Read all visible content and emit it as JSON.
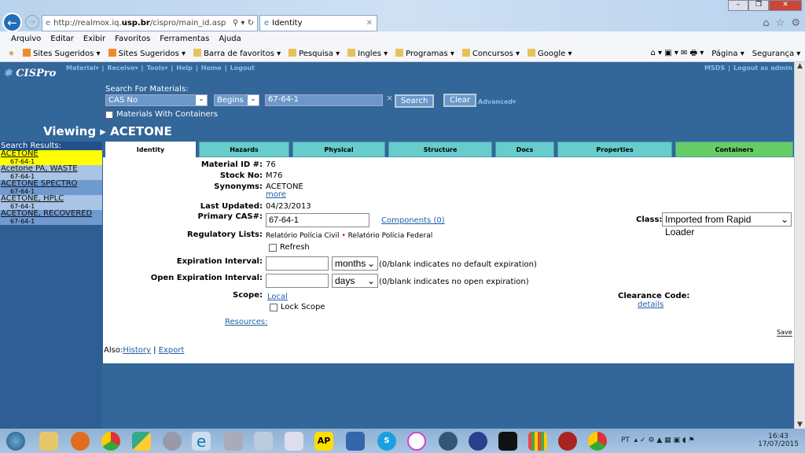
{
  "browser": {
    "url_prefix": "http://realmox.iq.",
    "url_domain": "usp.br",
    "url_suffix": "/cispro/main_id.asp",
    "tab_title": "Identity",
    "menu": [
      "Arquivo",
      "Editar",
      "Exibir",
      "Favoritos",
      "Ferramentas",
      "Ajuda"
    ],
    "favorites": [
      "Sites Sugeridos ▾",
      "Sites Sugeridos ▾",
      "Barra de favoritos ▾",
      "Pesquisa ▾",
      "Ingles ▾",
      "Programas ▾",
      "Concursos ▾",
      "Google ▾"
    ],
    "command_bar": {
      "page": "Página ▾",
      "security": "Segurança ▾"
    }
  },
  "app": {
    "logo": "CISPro",
    "nav": [
      "Material▾",
      "Receive▾",
      "Tools▾",
      "Help",
      "Home",
      "Logout"
    ],
    "right_nav": [
      "MSDS",
      "Logout as admin"
    ],
    "search": {
      "label": "Search For Materials:",
      "field": "CAS No",
      "operator": "Begins",
      "value": "67-64-1",
      "search_btn": "Search",
      "clear_btn": "Clear",
      "advanced": "Advanced▾",
      "with_containers": "Materials With Containers"
    },
    "viewing_label": "Viewing",
    "viewing_name": "ACETONE",
    "results_header": "Search Results:",
    "results": [
      {
        "name": "ACETONE",
        "cas": "67-64-1"
      },
      {
        "name": "Acetone PA, WASTE",
        "cas": "67-64-1"
      },
      {
        "name": "ACETONE SPECTRO",
        "cas": "67-64-1"
      },
      {
        "name": "ACETONE, HPLC",
        "cas": "67-64-1"
      },
      {
        "name": "ACETONE, RECOVERED",
        "cas": "67-64-1"
      }
    ],
    "tabs": [
      "Identity",
      "Hazards",
      "Physical",
      "Structure",
      "Docs",
      "Properties",
      "Containers"
    ],
    "identity": {
      "material_id_label": "Material ID #:",
      "material_id": "76",
      "stock_label": "Stock No:",
      "stock": "M76",
      "synonyms_label": "Synonyms:",
      "synonyms": "ACETONE",
      "more": "more",
      "updated_label": "Last Updated:",
      "updated": "04/23/2013",
      "cas_label": "Primary CAS#:",
      "cas": "67-64-1",
      "components": "Components (0)",
      "class_label": "Class:",
      "class": "Imported from Rapid Loader",
      "reg_label": "Regulatory Lists:",
      "reg1": "Relatório Polícia Civil",
      "reg2": "Relatório Polícia Federal",
      "refresh": "Refresh",
      "exp_label": "Expiration Interval:",
      "exp_unit": "months",
      "exp_note": "(0/blank indicates no default expiration)",
      "open_label": "Open Expiration Interval:",
      "open_unit": "days",
      "open_note": "(0/blank indicates no open expiration)",
      "scope_label": "Scope:",
      "scope": "Local",
      "lock_scope": "Lock Scope",
      "clearance_label": "Clearance Code:",
      "details": "details",
      "resources": "Resources:",
      "save": "Save",
      "also": "Also:",
      "history": "History",
      "export": "Export"
    }
  },
  "taskbar": {
    "lang": "PT",
    "time": "16:43",
    "date": "17/07/2015"
  }
}
